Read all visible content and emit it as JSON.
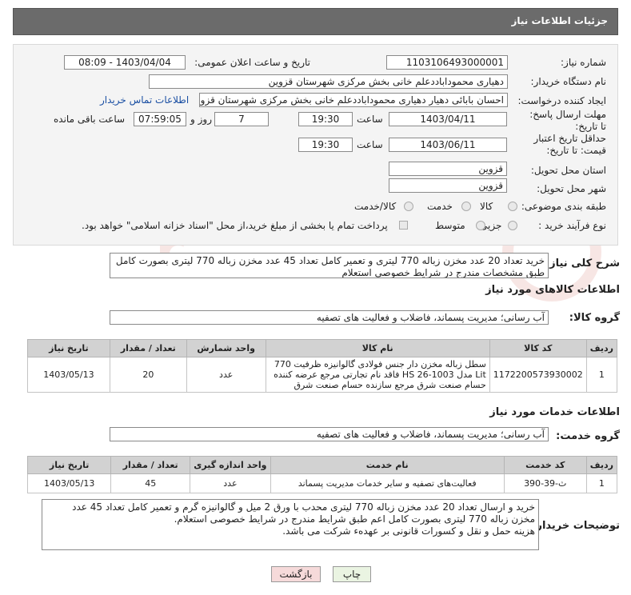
{
  "header": {
    "title": "جزئیات اطلاعات نیاز"
  },
  "form": {
    "need_number_label": "شماره نیاز:",
    "need_number": "1103106493000001",
    "announce_label": "تاریخ و ساعت اعلان عمومی:",
    "announce_value": "1403/04/04 - 08:09",
    "buyer_label": "نام دستگاه خریدار:",
    "buyer_value": "دهیاری محموداباددعلم خانی بخش مرکزی شهرستان قزوین",
    "creator_label": "ایجاد کننده درخواست:",
    "creator_value": "احسان بابائی دهیار دهیاری محموداباددعلم خانی بخش مرکزی شهرستان قزوین",
    "contact_link": "اطلاعات تماس خریدار",
    "deadline_label": "مهلت ارسال پاسخ: تا تاریخ:",
    "deadline_date": "1403/04/11",
    "time_label": "ساعت",
    "deadline_time": "19:30",
    "days_value": "7",
    "days_label": "روز و",
    "remaining_time": "07:59:05",
    "remaining_label": "ساعت باقی مانده",
    "validity_label": "حداقل تاریخ اعتبار قیمت: تا تاریخ:",
    "validity_date": "1403/06/11",
    "validity_time": "19:30",
    "province_label": "استان محل تحویل:",
    "province_value": "قزوین",
    "city_label": "شهر محل تحویل:",
    "city_value": "قزوین",
    "category_label": "طبقه بندی موضوعی:",
    "category_options": [
      "کالا",
      "خدمت",
      "کالا/خدمت"
    ],
    "process_label": "نوع فرآیند خرید :",
    "process_options": [
      "جزیی",
      "متوسط"
    ],
    "payment_note": "پرداخت تمام یا بخشی از مبلغ خرید،از محل \"اسناد خزانه اسلامی\" خواهد بود."
  },
  "summary": {
    "label": "شرح کلی نیاز:",
    "text": "خرید تعداد 20 عدد مخزن زباله 770 لیتری و تعمیر کامل تعداد 45 عدد مخزن زباله 770 لیتری بصورت کامل طبق مشخصات مندرج در شرایط خصوصی استعلام"
  },
  "goods": {
    "section_title": "اطلاعات کالاهای مورد نیاز",
    "group_label": "گروه کالا:",
    "group_value": "آب رسانی؛ مدیریت پسماند، فاضلاب و فعالیت های تصفیه",
    "columns": [
      "ردیف",
      "کد کالا",
      "نام کالا",
      "واحد شمارش",
      "تعداد / مقدار",
      "تاریخ نیاز"
    ],
    "rows": [
      {
        "index": "1",
        "code": "1172200573930002",
        "name": "سطل زباله مخزن دار جنس فولادی گالوانیزه ظرفیت 770 Lit مدل HS 26-1003 فاقد نام تجارتی مرجع عرضه کننده حسام صنعت شرق مرجع سازنده حسام صنعت شرق",
        "unit": "عدد",
        "qty": "20",
        "date": "1403/05/13"
      }
    ]
  },
  "services": {
    "section_title": "اطلاعات خدمات مورد نیاز",
    "group_label": "گروه خدمت:",
    "group_value": "آب رسانی؛ مدیریت پسماند، فاضلاب و فعالیت های تصفیه",
    "columns": [
      "ردیف",
      "کد خدمت",
      "نام خدمت",
      "واحد اندازه گیری",
      "تعداد / مقدار",
      "تاریخ نیاز"
    ],
    "rows": [
      {
        "index": "1",
        "code": "ث-39-390",
        "name": "فعالیت‌های تصفیه و سایر خدمات مدیریت پسماند",
        "unit": "عدد",
        "qty": "45",
        "date": "1403/05/13"
      }
    ]
  },
  "buyer_notes": {
    "label": "توضیحات خریدار:",
    "line1": "خرید و ارسال تعداد 20 عدد مخزن زباله 770 لیتری محدب با ورق 2 میل و گالوانیزه گرم و تعمیر کامل تعداد 45 عدد مخزن زباله 770 لیتری بصورت کامل اعم طبق شرایط مندرج در شرایط خصوصی استعلام.",
    "line2": "هزینه حمل و نقل و کسورات قانونی بر عهدهء شرکت می باشد."
  },
  "buttons": {
    "print": "چاپ",
    "back": "بازگشت"
  },
  "colors": {
    "header": "#6b6b6b",
    "link": "#1a4fa3",
    "back_button": "#f6dada",
    "print_button": "#eaf4e2"
  }
}
